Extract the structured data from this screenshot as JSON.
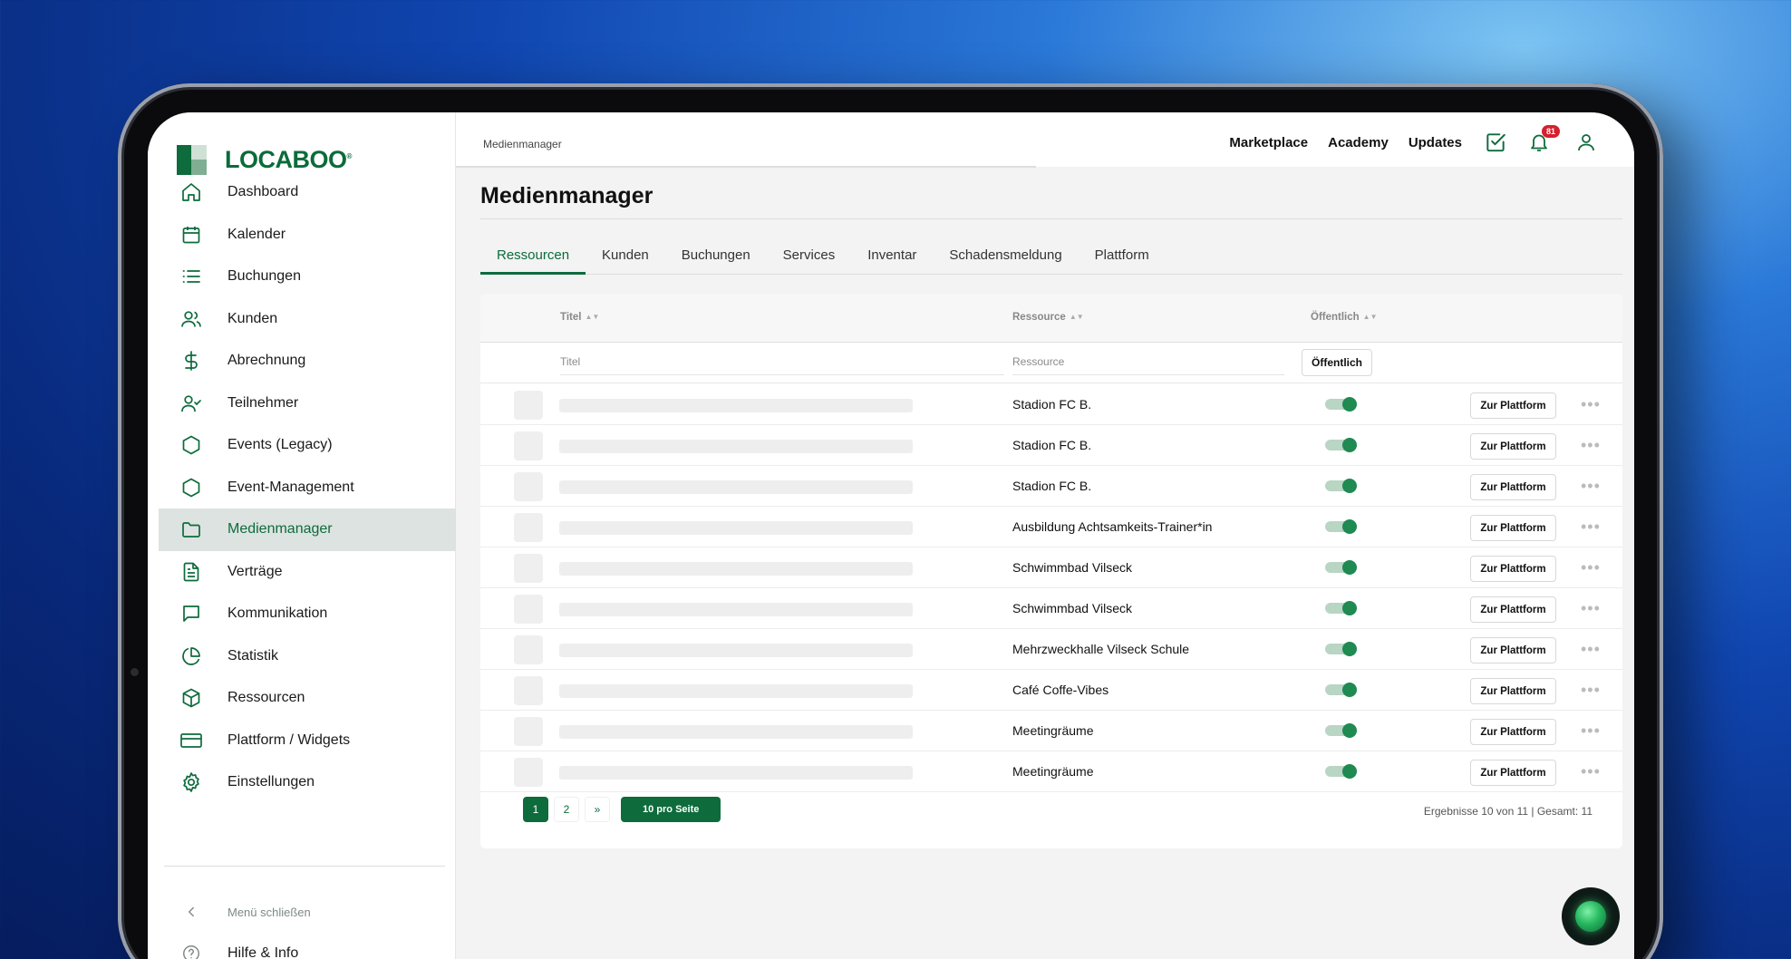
{
  "brand": {
    "name": "LOCABOO",
    "registered": "®",
    "accent": "#0d6b3c"
  },
  "sidebar": {
    "items": [
      {
        "label": "Dashboard",
        "icon": "home-icon"
      },
      {
        "label": "Kalender",
        "icon": "calendar-icon"
      },
      {
        "label": "Buchungen",
        "icon": "list-icon"
      },
      {
        "label": "Kunden",
        "icon": "users-icon"
      },
      {
        "label": "Abrechnung",
        "icon": "dollar-icon"
      },
      {
        "label": "Teilnehmer",
        "icon": "user-check-icon"
      },
      {
        "label": "Events (Legacy)",
        "icon": "hexagon-icon"
      },
      {
        "label": "Event-Management",
        "icon": "hexagon-icon"
      },
      {
        "label": "Medienmanager",
        "icon": "folder-icon",
        "active": true
      },
      {
        "label": "Verträge",
        "icon": "document-icon"
      },
      {
        "label": "Kommunikation",
        "icon": "message-icon"
      },
      {
        "label": "Statistik",
        "icon": "pie-chart-icon"
      },
      {
        "label": "Ressourcen",
        "icon": "box-icon"
      },
      {
        "label": "Plattform / Widgets",
        "icon": "credit-card-icon"
      },
      {
        "label": "Einstellungen",
        "icon": "gear-icon"
      }
    ],
    "close_menu": "Menü schließen",
    "help": "Hilfe & Info"
  },
  "topbar": {
    "breadcrumb": "Medienmanager",
    "links": [
      "Marketplace",
      "Academy",
      "Updates"
    ],
    "notification_count": "81"
  },
  "page": {
    "title": "Medienmanager",
    "tabs": [
      "Ressourcen",
      "Kunden",
      "Buchungen",
      "Services",
      "Inventar",
      "Schadensmeldung",
      "Plattform"
    ],
    "active_tab": "Ressourcen"
  },
  "table": {
    "columns": {
      "title": "Titel",
      "resource": "Ressource",
      "public": "Öffentlich"
    },
    "filters": {
      "title_placeholder": "Titel",
      "resource_placeholder": "Ressource",
      "public_button": "Öffentlich"
    },
    "row_button": "Zur Plattform",
    "rows": [
      {
        "resource": "Stadion FC B.",
        "public": true
      },
      {
        "resource": "Stadion FC B.",
        "public": true
      },
      {
        "resource": "Stadion FC B.",
        "public": true
      },
      {
        "resource": "Ausbildung Achtsamkeits-Trainer*in",
        "public": true
      },
      {
        "resource": "Schwimmbad Vilseck",
        "public": true
      },
      {
        "resource": "Schwimmbad Vilseck",
        "public": true
      },
      {
        "resource": "Mehrzweckhalle Vilseck Schule",
        "public": true
      },
      {
        "resource": "Café Coffe-Vibes",
        "public": true
      },
      {
        "resource": "Meetingräume",
        "public": true
      },
      {
        "resource": "Meetingräume",
        "public": true
      }
    ]
  },
  "pagination": {
    "pages": [
      "1",
      "2"
    ],
    "next": "»",
    "per_page": "10 pro Seite",
    "summary": "Ergebnisse 10 von 11 | Gesamt: 11"
  }
}
